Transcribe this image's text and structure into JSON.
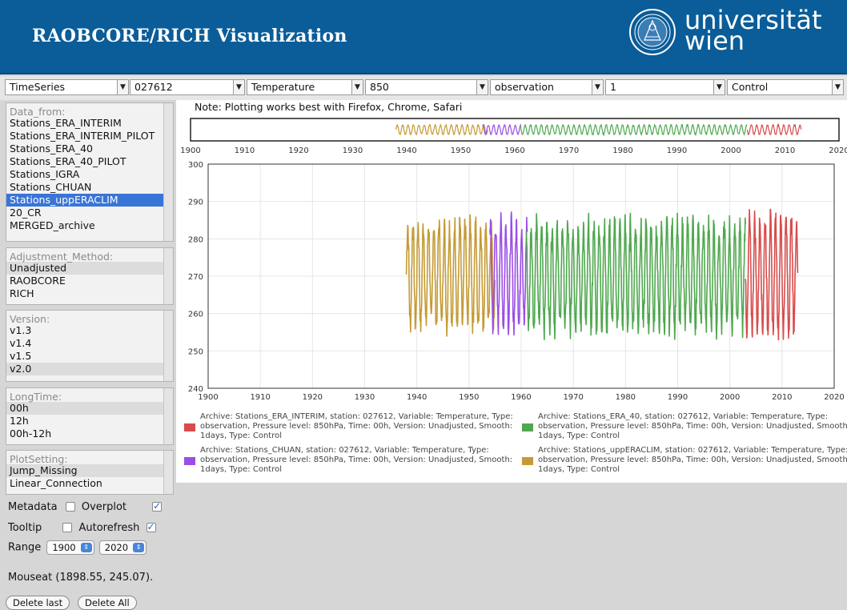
{
  "header": {
    "title": "RAOBCORE/RICH Visualization",
    "university_line1": "universität",
    "university_line2": "wien"
  },
  "toolbar": {
    "selects": [
      {
        "name": "plot-type-select",
        "value": "TimeSeries"
      },
      {
        "name": "station-select",
        "value": "027612"
      },
      {
        "name": "variable-select",
        "value": "Temperature"
      },
      {
        "name": "pressure-level-select",
        "value": "850"
      },
      {
        "name": "type-select",
        "value": "observation"
      },
      {
        "name": "smooth-select",
        "value": "1"
      },
      {
        "name": "control-select",
        "value": "Control"
      }
    ]
  },
  "panels": {
    "data_from": {
      "header": "Data_from:",
      "items": [
        "Stations_ERA_INTERIM",
        "Stations_ERA_INTERIM_PILOT",
        "Stations_ERA_40",
        "Stations_ERA_40_PILOT",
        "Stations_IGRA",
        "Stations_CHUAN",
        "Stations_uppERACLIM",
        "20_CR",
        "MERGED_archive"
      ],
      "active_index": 6
    },
    "adjustment": {
      "header": "Adjustment_Method:",
      "items": [
        "Unadjusted",
        "RAOBCORE",
        "RICH"
      ],
      "selected_index": 0
    },
    "version": {
      "header": "Version:",
      "items": [
        "v1.3",
        "v1.4",
        "v1.5",
        "v2.0"
      ],
      "selected_index": 3
    },
    "longtime": {
      "header": "LongTime:",
      "items": [
        "00h",
        "12h",
        "00h-12h"
      ],
      "selected_index": 0
    },
    "plotsetting": {
      "header": "PlotSetting:",
      "items": [
        "Jump_Missing",
        "Linear_Connection"
      ],
      "selected_index": 0
    }
  },
  "controls": {
    "metadata_label": "Metadata",
    "metadata_checked": false,
    "overplot_label": "Overplot",
    "overplot_checked": true,
    "tooltip_label": "Tooltip",
    "autorefresh_label": "Autorefresh",
    "autorefresh_checked": true,
    "range_label": "Range",
    "range_from": "1900",
    "range_to": "2020",
    "mouseat": "Mouseat (1898.55, 245.07).",
    "delete_last": "Delete last",
    "delete_all": "Delete All"
  },
  "note": "Note: Plotting works best with Firefox, Chrome, Safari",
  "chart_data": {
    "type": "line",
    "xlim": [
      1900,
      2020
    ],
    "ylim": [
      240,
      300
    ],
    "x_ticks": [
      "1900",
      "1910",
      "1920",
      "1930",
      "1940",
      "1950",
      "1960",
      "1970",
      "1980",
      "1990",
      "2000",
      "2010",
      "2020"
    ],
    "y_ticks": [
      "240",
      "250",
      "260",
      "270",
      "280",
      "290",
      "300"
    ],
    "grid": true,
    "series": [
      {
        "archive": "Stations_uppERACLIM",
        "color": "#c49a33",
        "start": 1938.0,
        "end": 1955.0,
        "mean": 270.5,
        "amplitude": 13.5
      },
      {
        "archive": "Stations_CHUAN",
        "color": "#9b4de6",
        "start": 1954.0,
        "end": 1961.2,
        "mean": 270.5,
        "amplitude": 13.5
      },
      {
        "archive": "Stations_ERA_40",
        "color": "#4fa84f",
        "start": 1961.0,
        "end": 2003.0,
        "mean": 270.0,
        "amplitude": 13.5
      },
      {
        "archive": "Stations_ERA_INTERIM",
        "color": "#d84b4b",
        "start": 2003.0,
        "end": 2013.0,
        "mean": 270.5,
        "amplitude": 14.5
      }
    ],
    "legend": [
      {
        "color": "#d84b4b",
        "text": "Archive: Stations_ERA_INTERIM, station: 027612, Variable: Temperature, Type: observation, Pressure level: 850hPa, Time: 00h, Version: Unadjusted, Smooth: 1days, Type: Control"
      },
      {
        "color": "#4fa84f",
        "text": "Archive: Stations_ERA_40, station: 027612, Variable: Temperature, Type: observation, Pressure level: 850hPa, Time: 00h, Version: Unadjusted, Smooth: 1days, Type: Control"
      },
      {
        "color": "#9b4de6",
        "text": "Archive: Stations_CHUAN, station: 027612, Variable: Temperature, Type: observation, Pressure level: 850hPa, Time: 00h, Version: Unadjusted, Smooth: 1days, Type: Control"
      },
      {
        "color": "#c49a33",
        "text": "Archive: Stations_uppERACLIM, station: 027612, Variable: Temperature, Type: observation, Pressure level: 850hPa, Time: 00h, Version: Unadjusted, Smooth: 1days, Type: Control"
      }
    ]
  }
}
